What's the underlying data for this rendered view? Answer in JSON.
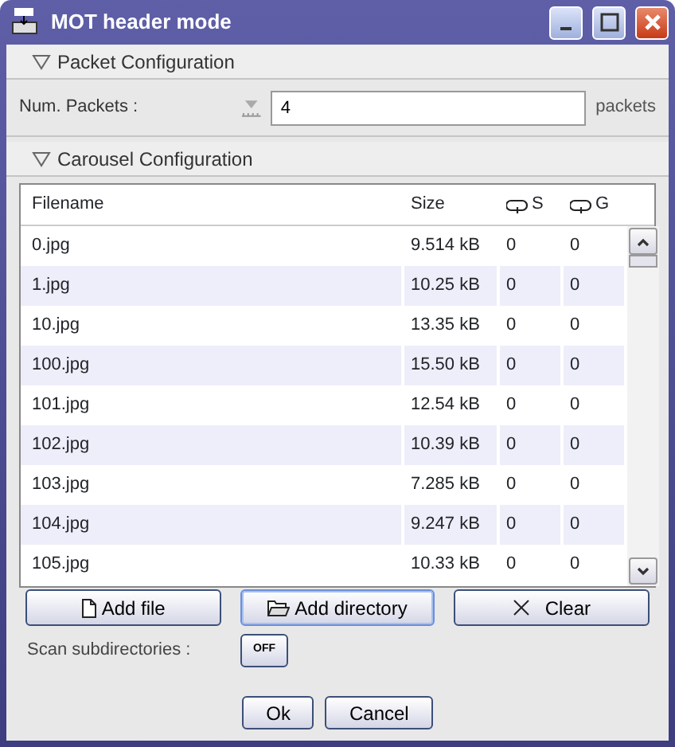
{
  "window": {
    "title": "MOT header mode"
  },
  "packet_section": {
    "title": "Packet Configuration",
    "expanded": true
  },
  "packets": {
    "label": "Num. Packets :",
    "value": "4",
    "unit": "packets"
  },
  "carousel_section": {
    "title": "Carousel Configuration",
    "expanded": true
  },
  "table": {
    "columns": [
      "Filename",
      "Size",
      "S",
      "G"
    ],
    "rows": [
      {
        "cells": [
          "0.jpg",
          "9.514 kB",
          "0",
          "0"
        ]
      },
      {
        "cells": [
          "1.jpg",
          "10.25 kB",
          "0",
          "0"
        ]
      },
      {
        "cells": [
          "10.jpg",
          "13.35 kB",
          "0",
          "0"
        ]
      },
      {
        "cells": [
          "100.jpg",
          "15.50 kB",
          "0",
          "0"
        ]
      },
      {
        "cells": [
          "101.jpg",
          "12.54 kB",
          "0",
          "0"
        ]
      },
      {
        "cells": [
          "102.jpg",
          "10.39 kB",
          "0",
          "0"
        ]
      },
      {
        "cells": [
          "103.jpg",
          "7.285 kB",
          "0",
          "0"
        ]
      },
      {
        "cells": [
          "104.jpg",
          "9.247 kB",
          "0",
          "0"
        ]
      },
      {
        "cells": [
          "105.jpg",
          "10.33 kB",
          "0",
          "0"
        ]
      }
    ]
  },
  "file_buttons": [
    {
      "kind": "file",
      "label": "Add file",
      "focused": false
    },
    {
      "kind": "folder",
      "label": "Add directory",
      "focused": true
    },
    {
      "kind": "clear",
      "label": "Clear",
      "focused": false
    }
  ],
  "scan": {
    "label": "Scan subdirectories :",
    "toggle": "OFF",
    "on": false
  },
  "dialog_buttons": [
    "Ok",
    "Cancel"
  ]
}
